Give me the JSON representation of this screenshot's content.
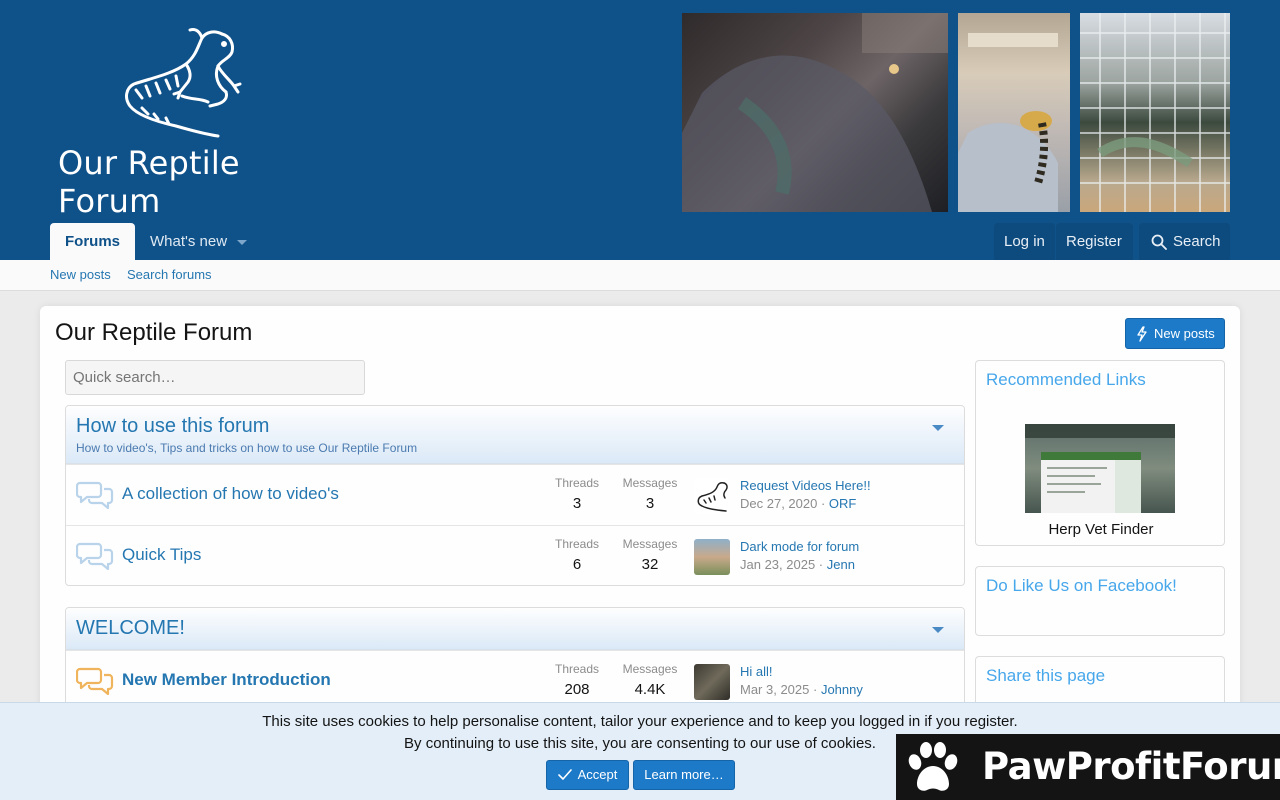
{
  "header": {
    "logo_text": "Our Reptile Forum"
  },
  "nav": {
    "tabs": [
      {
        "label": "Forums",
        "active": true
      },
      {
        "label": "What's new",
        "active": false
      }
    ],
    "login": "Log in",
    "register": "Register",
    "search": "Search"
  },
  "subnav": {
    "new_posts": "New posts",
    "search_forums": "Search forums"
  },
  "page": {
    "title": "Our Reptile Forum",
    "new_posts_button": "New posts",
    "quick_search_placeholder": "Quick search…"
  },
  "categories": [
    {
      "title": "How to use this forum",
      "description": "How to video's, Tips and tricks on how to use Our Reptile Forum",
      "nodes": [
        {
          "title": "A collection of how to video's",
          "threads_label": "Threads",
          "threads": "3",
          "messages_label": "Messages",
          "messages": "3",
          "last_title": "Request Videos Here!!",
          "last_date": "Dec 27, 2020",
          "last_user": "ORF"
        },
        {
          "title": "Quick Tips",
          "threads_label": "Threads",
          "threads": "6",
          "messages_label": "Messages",
          "messages": "32",
          "last_title": "Dark mode for forum",
          "last_date": "Jan 23, 2025",
          "last_user": "Jenn"
        }
      ]
    },
    {
      "title": "WELCOME!",
      "description": "",
      "nodes": [
        {
          "title": "New Member Introduction",
          "threads_label": "Threads",
          "threads": "208",
          "messages_label": "Messages",
          "messages": "4.4K",
          "last_title": "Hi all!",
          "last_date": "Mar 3, 2025",
          "last_user": "Johnny"
        }
      ]
    }
  ],
  "sidebar": {
    "recommended_links": "Recommended Links",
    "vet_caption": "Herp Vet Finder",
    "facebook": "Do Like Us on Facebook!",
    "share": "Share this page"
  },
  "cookie": {
    "line1": "This site uses cookies to help personalise content, tailor your experience and to keep you logged in if you register.",
    "line2": "By continuing to use this site, you are consenting to our use of cookies.",
    "accept": "Accept",
    "learn_more": "Learn more…"
  },
  "badge": {
    "text": "PawProfitForum"
  },
  "colors": {
    "header_bg": "#0f5189",
    "link": "#2577b1",
    "button": "#1c7ac9",
    "unread_icon": "#f0b55c"
  }
}
